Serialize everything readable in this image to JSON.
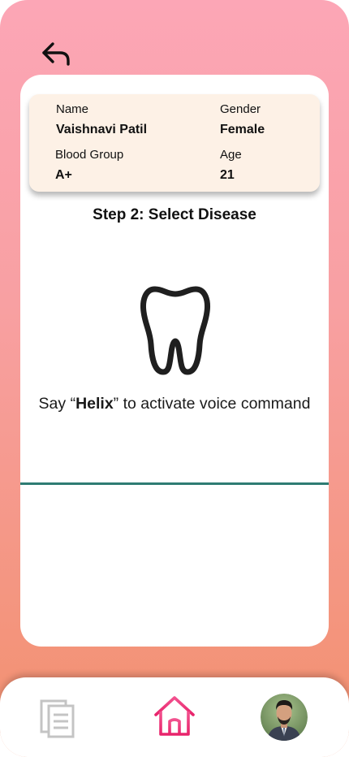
{
  "patient": {
    "name_label": "Name",
    "name_value": "Vaishnavi Patil",
    "gender_label": "Gender",
    "gender_value": "Female",
    "blood_label": "Blood Group",
    "blood_value": "A+",
    "age_label": "Age",
    "age_value": "21"
  },
  "step": {
    "title": "Step 2: Select Disease"
  },
  "voice": {
    "prefix": "Say “",
    "keyword": "Helix",
    "suffix": "” to activate voice command"
  },
  "icons": {
    "back": "back-arrow-icon",
    "tooth": "tooth-icon",
    "documents": "documents-icon",
    "home": "home-icon",
    "avatar": "user-avatar"
  },
  "colors": {
    "gradient_top": "#fca6b6",
    "gradient_bottom": "#f2906e",
    "info_card_bg": "#fdf1e6",
    "divider": "#2e7c73",
    "home_icon_top": "#f2528f",
    "home_icon_bottom": "#e8236b",
    "docs_icon": "#c4c4c4"
  }
}
